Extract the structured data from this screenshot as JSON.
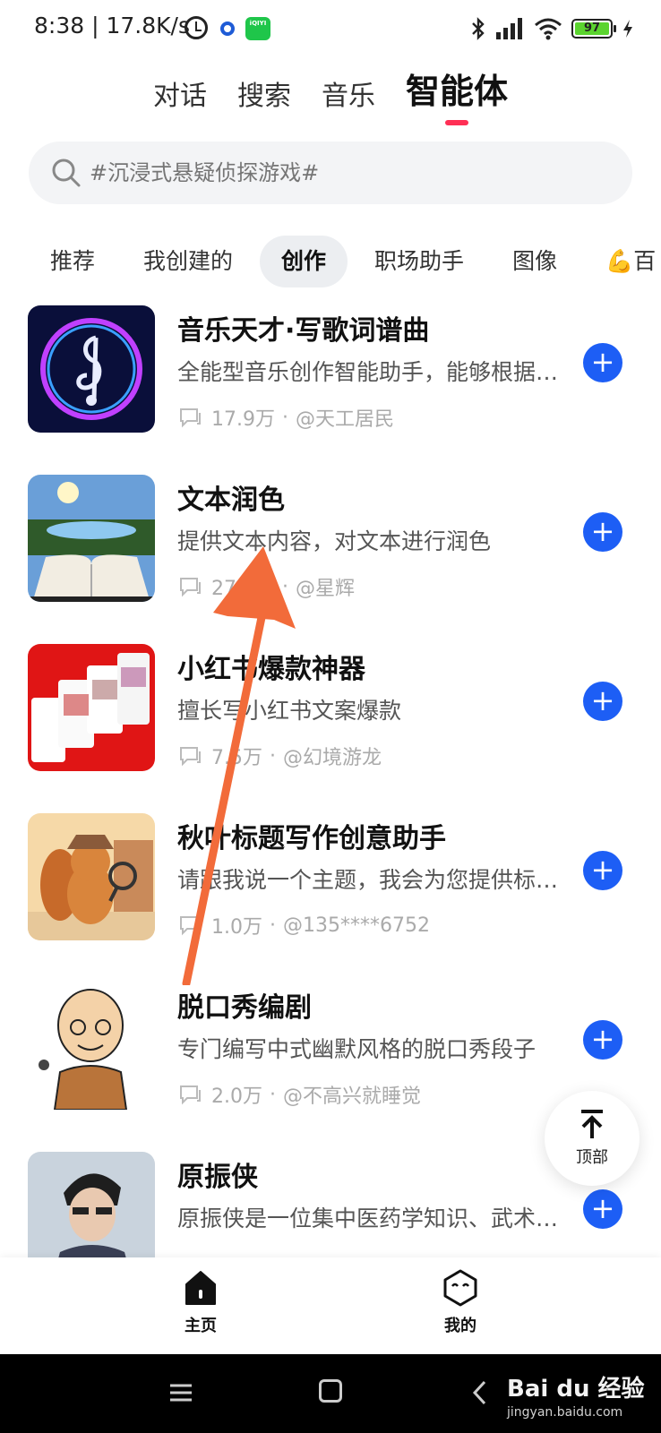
{
  "status_bar": {
    "time": "8:38 | 17.8K/s",
    "iqiyi_badge": "iQIYI",
    "battery_level": "97",
    "icons": [
      "alarm-icon",
      "circle-dot-icon",
      "iqiyi-app-icon",
      "bluetooth-icon",
      "signal-icon",
      "wifi-icon",
      "battery-icon",
      "charging-icon"
    ]
  },
  "top_tabs": [
    {
      "label": "对话",
      "active": false
    },
    {
      "label": "搜索",
      "active": false
    },
    {
      "label": "音乐",
      "active": false
    },
    {
      "label": "智能体",
      "active": true
    }
  ],
  "search": {
    "placeholder": "#沉浸式悬疑侦探游戏#"
  },
  "categories": [
    {
      "label": "推荐",
      "active": false
    },
    {
      "label": "我创建的",
      "active": false
    },
    {
      "label": "创作",
      "active": true
    },
    {
      "label": "职场助手",
      "active": false
    },
    {
      "label": "图像",
      "active": false
    },
    {
      "label": "💪百",
      "active": false
    }
  ],
  "agents": [
    {
      "title": "音乐天才·写歌词谱曲",
      "desc": "全能型音乐创作智能助手，能够根据您的需求",
      "count": "17.9万",
      "author": "@天工居民"
    },
    {
      "title": "文本润色",
      "desc": "提供文本内容，对文本进行润色",
      "count": "27.8万",
      "author": "@星辉"
    },
    {
      "title": "小红书爆款神器",
      "desc": "擅长写小红书文案爆款",
      "count": "7.5万",
      "author": "@幻境游龙"
    },
    {
      "title": "秋叶标题写作创意助手",
      "desc": "请跟我说一个主题，我会为您提供标题创意",
      "count": "1.0万",
      "author": "@135****6752"
    },
    {
      "title": "脱口秀编剧",
      "desc": "专门编写中式幽默风格的脱口秀段子",
      "count": "2.0万",
      "author": "@不高兴就睡觉"
    },
    {
      "title": "原振侠",
      "desc": "原振侠是一位集中医药学知识、武术于一身的",
      "count": "",
      "author": ""
    }
  ],
  "separator": "·",
  "add_label": "+",
  "to_top": {
    "label": "顶部"
  },
  "bottom_nav": {
    "home_label": "主页",
    "me_label": "我的"
  },
  "watermark": {
    "brand": "Bai du 经验",
    "url": "jingyan.baidu.com"
  },
  "colors": {
    "accent_blue": "#1d5ef5",
    "tab_indicator": "#ff2f55",
    "annotation_arrow": "#f26b3a"
  }
}
